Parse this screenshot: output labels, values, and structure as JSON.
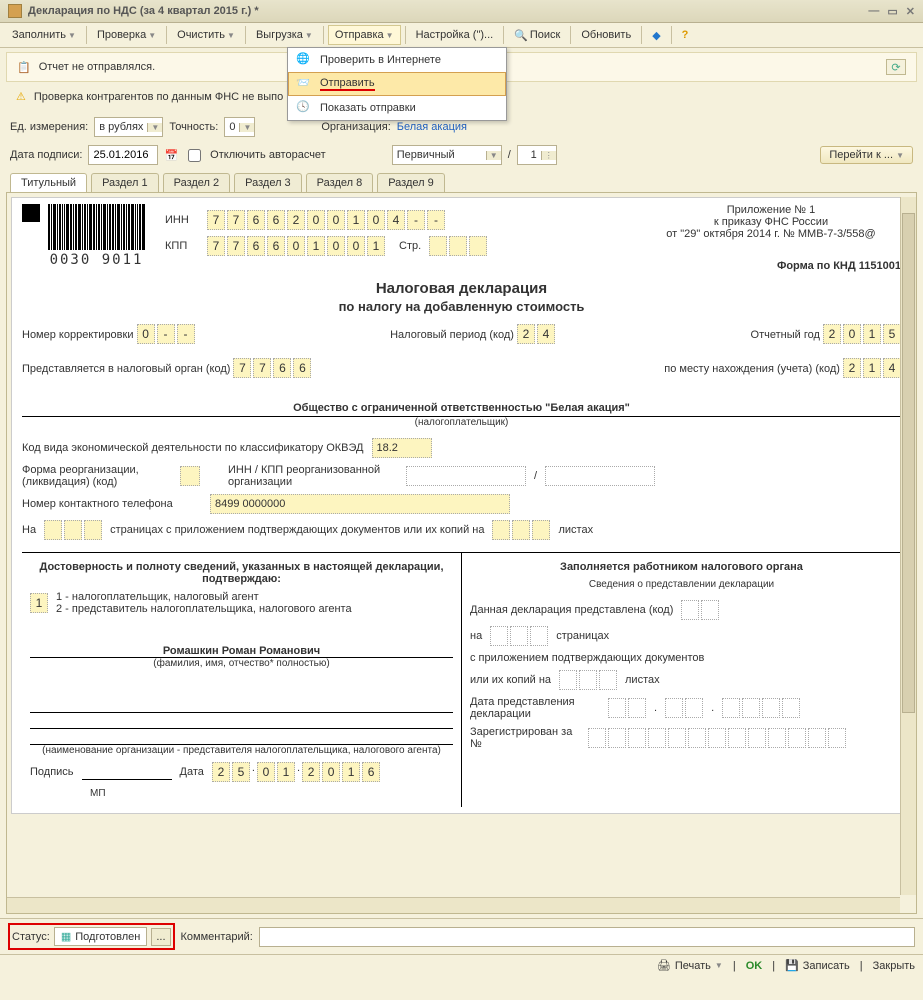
{
  "window": {
    "title": "Декларация по НДС (за 4 квартал 2015 г.) *"
  },
  "toolbar": {
    "fill": "Заполнить",
    "check": "Проверка",
    "clear": "Очистить",
    "export": "Выгрузка",
    "send": "Отправка",
    "settings": "Настройка (\")...",
    "search": "Поиск",
    "update": "Обновить"
  },
  "dropdown": {
    "check_internet": "Проверить в Интернете",
    "send": "Отправить",
    "show_sends": "Показать отправки"
  },
  "info": {
    "not_sent": "Отчет не отправлялся.",
    "fns_warn": "Проверка контрагентов по данным ФНС не выпо"
  },
  "params": {
    "unit_label": "Ед. измерения:",
    "unit_value": "в рублях",
    "precision_label": "Точность:",
    "precision_value": "0",
    "org_label": "Организация:",
    "org_value": "Белая акация",
    "sign_date_label": "Дата подписи:",
    "sign_date": "25.01.2016",
    "disable_auto": "Отключить авторасчет",
    "primary": "Первичный",
    "slash": "/",
    "corr_num": "1",
    "goto": "Перейти к ..."
  },
  "tabs": [
    "Титульный",
    "Раздел 1",
    "Раздел 2",
    "Раздел 3",
    "Раздел 8",
    "Раздел 9"
  ],
  "doc": {
    "barcode": "0030 9011",
    "inn_label": "ИНН",
    "inn": [
      "7",
      "7",
      "6",
      "6",
      "2",
      "0",
      "0",
      "1",
      "0",
      "4",
      "-",
      "-"
    ],
    "kpp_label": "КПП",
    "kpp": [
      "7",
      "7",
      "6",
      "6",
      "0",
      "1",
      "0",
      "0",
      "1"
    ],
    "page_label": "Стр.",
    "app_line1": "Приложение № 1",
    "app_line2": "к приказу ФНС России",
    "app_line3": "от \"29\" октября 2014 г. № ММВ-7-3/558@",
    "form_code": "Форма по КНД 1151001",
    "title1": "Налоговая декларация",
    "title2": "по налогу на добавленную стоимость",
    "corr_label": "Номер корректировки",
    "corr": [
      "0",
      "-",
      "-"
    ],
    "period_label": "Налоговый период  (код)",
    "period": [
      "2",
      "4"
    ],
    "year_label": "Отчетный год",
    "year": [
      "2",
      "0",
      "1",
      "5"
    ],
    "tax_org_label": "Представляется в налоговый орган  (код)",
    "tax_org": [
      "7",
      "7",
      "6",
      "6"
    ],
    "place_label": "по месту нахождения (учета) (код)",
    "place": [
      "2",
      "1",
      "4"
    ],
    "org_full": "Общество с ограниченной ответственностью \"Белая акация\"",
    "org_sub": "(налогоплательщик)",
    "okved_label": "Код вида экономической деятельности по классификатору ОКВЭД",
    "okved": "18.2",
    "reorg_label": "Форма реорганизации, (ликвидация) (код)",
    "reorg_inn_label": "ИНН / КПП реорганизованной организации",
    "phone_label": "Номер контактного телефона",
    "phone": "8499 0000000",
    "pages1": "На",
    "pages2": "страницах с приложением подтверждающих документов или их копий на",
    "pages3": "листах",
    "left_head": "Достоверность и полноту сведений, указанных в настоящей декларации, подтверждаю:",
    "opt_box": "1",
    "opt1": "1 - налогоплательщик, налоговый агент",
    "opt2": "2 - представитель налогоплательщика, налогового агента",
    "fio": "Ромашкин Роман Романович",
    "fio_sub": "(фамилия, имя, отчество* полностью)",
    "rep_sub": "(наименование организации - представителя налогоплательщика, налогового агента)",
    "sign_label": "Подпись",
    "mp": "МП",
    "date_label": "Дата",
    "sign_date": [
      "2",
      "5",
      "0",
      "1",
      "2",
      "0",
      "1",
      "6"
    ],
    "right_head": "Заполняется работником налогового органа",
    "right_sub": "Сведения о представлении декларации",
    "r1": "Данная декларация представлена  (код)",
    "r2a": "на",
    "r2b": "страницах",
    "r3": "с приложением подтверждающих документов",
    "r4a": "или их копий на",
    "r4b": "листах",
    "r5": "Дата представления декларации",
    "r6": "Зарегистрирован за №"
  },
  "status": {
    "label": "Статус:",
    "value": "Подготовлен",
    "comment_label": "Комментарий:"
  },
  "footer": {
    "print": "Печать",
    "ok": "OK",
    "save": "Записать",
    "close": "Закрыть"
  }
}
